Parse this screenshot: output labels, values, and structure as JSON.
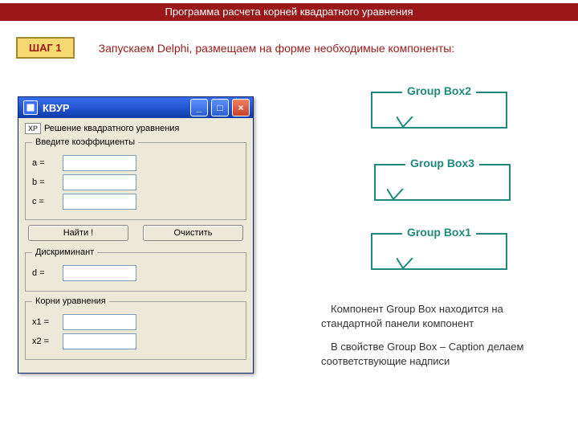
{
  "header": {
    "title": "Программа расчета корней квадратного уравнения"
  },
  "step": {
    "badge": "ШАГ 1",
    "text": "Запускаем Delphi, размещаем на форме необходимые компоненты:"
  },
  "xp_window": {
    "title": "КВУР",
    "manifest_label": "XP",
    "form_caption": "Решение квадратного уравнения",
    "group_coeffs": {
      "legend": "Введите коэффициенты",
      "labels": {
        "a": "a =",
        "b": "b =",
        "c": "c ="
      }
    },
    "buttons": {
      "find": "Найти !",
      "clear": "Очистить"
    },
    "group_disc": {
      "legend": "Дискриминант",
      "label": "d ="
    },
    "group_roots": {
      "legend": "Корни уравнения",
      "labels": {
        "x1": "x1 =",
        "x2": "x2 ="
      }
    },
    "win_buttons": {
      "min": "_",
      "max": "□",
      "close": "×"
    }
  },
  "callouts": {
    "box2": "Group Box2",
    "box3": "Group Box3",
    "box1": "Group Box1"
  },
  "notes": {
    "p1": "Компонент Group Box находится на стандартной панели компонент",
    "p2": "В свойстве Group Box – Caption делаем соответствующие надписи"
  }
}
